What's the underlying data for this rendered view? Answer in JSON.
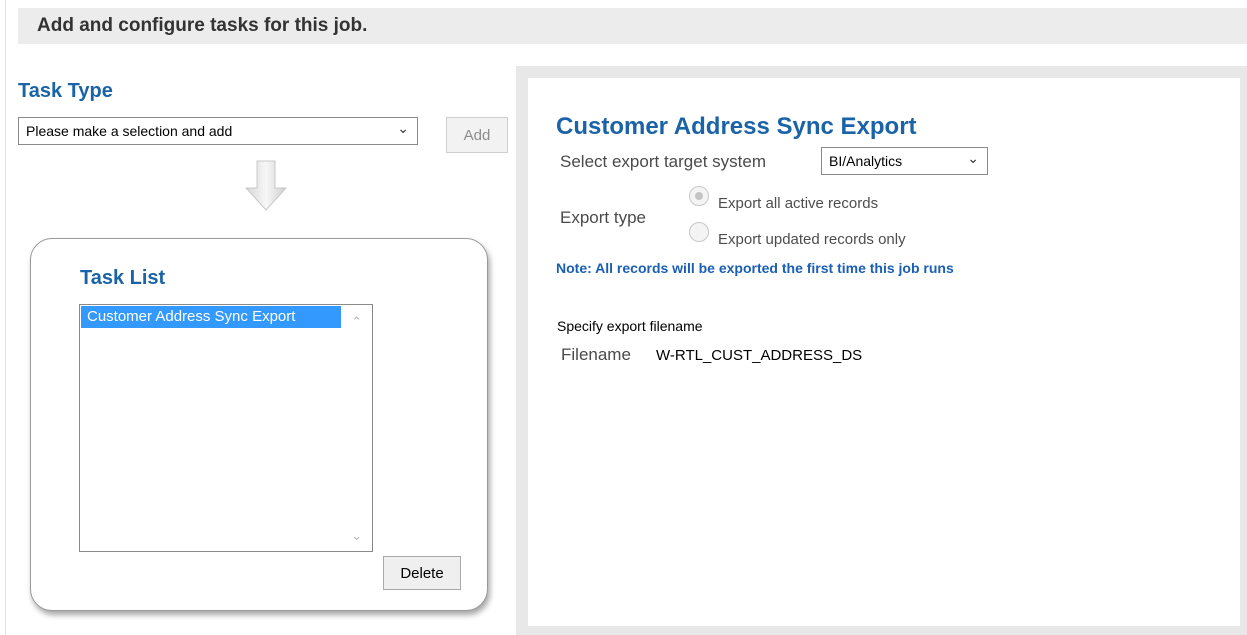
{
  "header": {
    "title": "Add and configure tasks for this job."
  },
  "task_type": {
    "title": "Task Type",
    "select_value": "Please make a selection and add",
    "add_label": "Add"
  },
  "task_list": {
    "title": "Task List",
    "items": [
      "Customer Address Sync Export"
    ],
    "selected_index": 0,
    "delete_label": "Delete"
  },
  "detail": {
    "title": "Customer Address Sync Export",
    "target_label": "Select export target system",
    "target_value": "BI/Analytics",
    "export_type_label": "Export type",
    "export_options": [
      {
        "label": "Export all active records",
        "checked": true,
        "disabled": true
      },
      {
        "label": "Export updated records only",
        "checked": false,
        "disabled": true
      }
    ],
    "note": "Note: All records will be exported the first time this job runs",
    "filename_heading": "Specify export filename",
    "filename_label": "Filename",
    "filename_value": "W-RTL_CUST_ADDRESS_DS"
  },
  "icons": {
    "dropdown": "chevron-down-icon",
    "flow_arrow": "arrow-down-icon",
    "scroll_up": "scroll-up-icon",
    "scroll_down": "scroll-down-icon"
  },
  "colors": {
    "accent_blue": "#1a63a8",
    "selection_blue": "#3399ff",
    "banner_gray": "#ececec"
  }
}
